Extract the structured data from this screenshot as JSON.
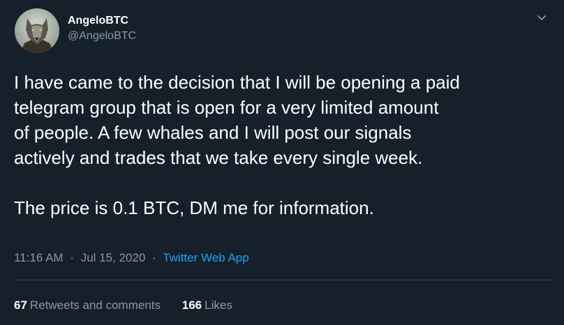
{
  "author": {
    "display_name": "AngeloBTC",
    "handle": "@AngeloBTC",
    "avatar_icon": "wolf-avatar"
  },
  "menu": {
    "icon": "chevron-down-icon"
  },
  "tweet": {
    "text": "I have came to the decision that I will be opening a paid\ntelegram group that is open for a very limited amount\nof people. A few whales and I will post our signals\nactively and trades that we take every single week.\n\nThe price is 0.1 BTC, DM me for information.",
    "time": "11:16 AM",
    "separator": "·",
    "date": "Jul 15, 2020",
    "source": "Twitter Web App"
  },
  "stats": {
    "retweets_count": "67",
    "retweets_label": "Retweets and comments",
    "likes_count": "166",
    "likes_label": "Likes"
  },
  "colors": {
    "background": "#15202b",
    "text_primary": "#ffffff",
    "text_secondary": "#8899a6",
    "accent": "#1da1f2",
    "divider": "#38444d"
  }
}
